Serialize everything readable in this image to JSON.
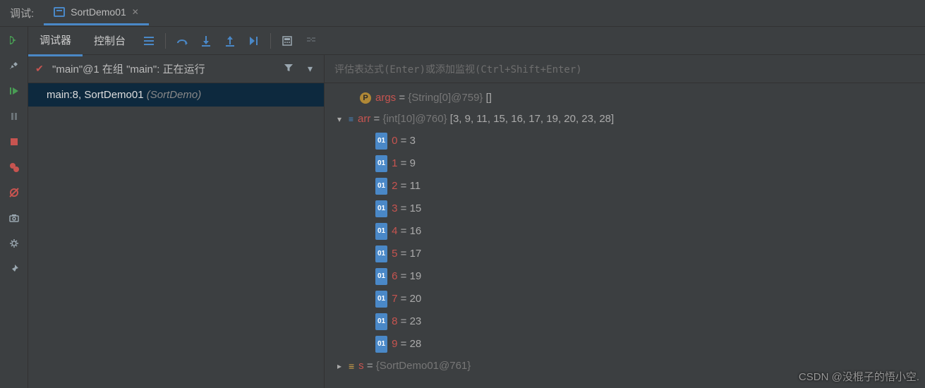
{
  "header": {
    "debug_label": "调试:",
    "tab_title": "SortDemo01"
  },
  "toolbar": {
    "tab_debugger": "调试器",
    "tab_console": "控制台"
  },
  "frames": {
    "thread_label": "\"main\"@1 在组 \"main\": 正在运行",
    "row_main": "main:8, SortDemo01",
    "row_suffix": "(SortDemo)"
  },
  "vars": {
    "placeholder": "评估表达式(Enter)或添加监视(Ctrl+Shift+Enter)",
    "args": {
      "name": "args",
      "type": "{String[0]@759}",
      "value": "[]"
    },
    "arr": {
      "name": "arr",
      "type": "{int[10]@760}",
      "preview": "[3, 9, 11, 15, 16, 17, 19, 20, 23, 28]",
      "items": [
        {
          "idx": "0",
          "val": "3"
        },
        {
          "idx": "1",
          "val": "9"
        },
        {
          "idx": "2",
          "val": "11"
        },
        {
          "idx": "3",
          "val": "15"
        },
        {
          "idx": "4",
          "val": "16"
        },
        {
          "idx": "5",
          "val": "17"
        },
        {
          "idx": "6",
          "val": "19"
        },
        {
          "idx": "7",
          "val": "20"
        },
        {
          "idx": "8",
          "val": "23"
        },
        {
          "idx": "9",
          "val": "28"
        }
      ]
    },
    "s": {
      "name": "s",
      "type": "{SortDemo01@761}"
    }
  },
  "watermark": "CSDN @没棍子的悟小空."
}
